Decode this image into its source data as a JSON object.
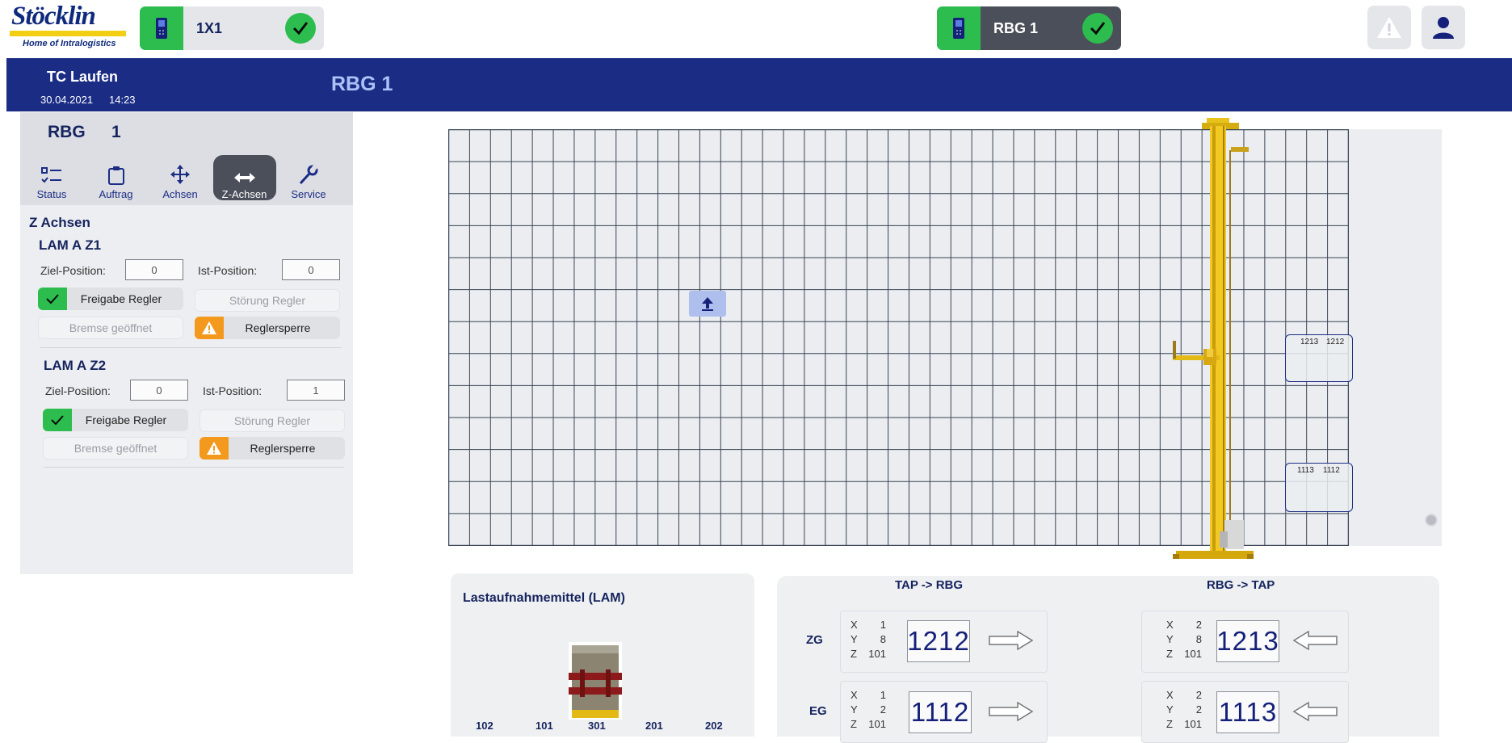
{
  "header": {
    "logo_title": "Stöcklin",
    "logo_subtitle": "Home of Intralogistics",
    "device_left": "1X1",
    "device_center": "RBG 1",
    "colors": {
      "brand_blue": "#1b2c84",
      "ok_green": "#2dbd4e",
      "warn_orange": "#f39a1e",
      "crane_yellow": "#f2c922"
    }
  },
  "title_bar": {
    "site": "TC Laufen",
    "date": "30.04.2021",
    "time": "14:23",
    "page_title": "RBG 1"
  },
  "sidebar": {
    "device_label": "RBG",
    "device_number": "1",
    "tabs": [
      {
        "label": "Status",
        "icon": "list-check-icon"
      },
      {
        "label": "Auftrag",
        "icon": "clipboard-icon"
      },
      {
        "label": "Achsen",
        "icon": "move-arrows-icon"
      },
      {
        "label": "Z-Achsen",
        "icon": "horizontal-arrows-icon",
        "active": true
      },
      {
        "label": "Service",
        "icon": "wrench-icon"
      }
    ],
    "section_title": "Z Achsen",
    "groups": [
      {
        "title": "LAM A Z1",
        "target_label": "Ziel-Position:",
        "target_value": "0",
        "actual_label": "Ist-Position:",
        "actual_value": "0",
        "release": "Freigabe Regler",
        "fault": "Störung Regler",
        "brake": "Bremse geöffnet",
        "lock": "Reglersperre"
      },
      {
        "title": "LAM A Z2",
        "target_label": "Ziel-Position:",
        "target_value": "0",
        "actual_label": "Ist-Position:",
        "actual_value": "1",
        "release": "Freigabe Regler",
        "fault": "Störung Regler",
        "brake": "Bremse geöffnet",
        "lock": "Reglersperre"
      }
    ]
  },
  "rack": {
    "columns": 43,
    "rows": 13,
    "slot_top": {
      "a": "1213",
      "b": "1212"
    },
    "slot_bottom": {
      "a": "1113",
      "b": "1112"
    }
  },
  "lam_panel": {
    "title": "Lastaufnahmemittel (LAM)",
    "positions": [
      "102",
      "101",
      "301",
      "201",
      "202"
    ]
  },
  "transfer_panel": {
    "col_left_title": "TAP -> RBG",
    "col_right_title": "RBG -> TAP",
    "rows": [
      {
        "label": "ZG",
        "left": {
          "x": "1",
          "y": "8",
          "z": "101",
          "code": "1212"
        },
        "right": {
          "x": "2",
          "y": "8",
          "z": "101",
          "code": "1213"
        }
      },
      {
        "label": "EG",
        "left": {
          "x": "1",
          "y": "2",
          "z": "101",
          "code": "1112"
        },
        "right": {
          "x": "2",
          "y": "2",
          "z": "101",
          "code": "1113"
        }
      }
    ],
    "axis_x": "X",
    "axis_y": "Y",
    "axis_z": "Z"
  }
}
